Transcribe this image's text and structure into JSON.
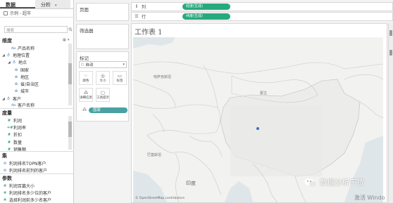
{
  "left_pane": {
    "tabs": [
      "数据",
      "分析"
    ],
    "data_source": "示例 - 超市",
    "search_placeholder": "搜索",
    "dimensions_header": "维度",
    "dimensions": [
      {
        "label": "产品名称",
        "icon": "abc-icon",
        "indent": 2
      },
      {
        "label": "地理位置",
        "icon": "hierarchy-icon",
        "indent": 0,
        "expanded": true
      },
      {
        "label": "地点",
        "icon": "hierarchy-icon",
        "indent": 1,
        "expanded": true
      },
      {
        "label": "国家",
        "icon": "globe-icon",
        "indent": 2
      },
      {
        "label": "地区",
        "icon": "globe-icon",
        "indent": 2
      },
      {
        "label": "省/自治区",
        "icon": "globe-icon",
        "indent": 2
      },
      {
        "label": "城市",
        "icon": "globe-icon",
        "indent": 2
      },
      {
        "label": "客户",
        "icon": "hierarchy-icon",
        "indent": 0,
        "expanded": true
      },
      {
        "label": "客户名称",
        "icon": "abc-icon",
        "indent": 2
      }
    ],
    "measures_header": "度量",
    "measures": [
      "利润",
      "利润率",
      "折扣",
      "数量",
      "销售额"
    ],
    "sets_header": "集",
    "sets": [
      "利润排名TOPN客户",
      "利润排名前列的客户"
    ],
    "params_header": "参数",
    "params": [
      "利润百篇大小",
      "利润排名多少位的客户",
      "选择利润前多少名客户"
    ]
  },
  "cards": {
    "pages": "页面",
    "filters": "筛选器",
    "marks": "标记",
    "mark_type": "自动",
    "buttons": [
      {
        "label": "颜色",
        "icon": "color-icon"
      },
      {
        "label": "大小",
        "icon": "size-icon"
      },
      {
        "label": "标签",
        "icon": "label-icon"
      },
      {
        "label": "详细信息",
        "icon": "detail-icon"
      },
      {
        "label": "工具提示",
        "icon": "tooltip-icon"
      }
    ],
    "detail_pill": "国家"
  },
  "shelves": {
    "columns_label": "列",
    "columns_pill": "经度(生成)",
    "rows_label": "行",
    "rows_pill": "纬度(生成)"
  },
  "view": {
    "sheet_title": "工作表 1",
    "map_labels": [
      "哈萨克斯坦",
      "蒙古",
      "巴基斯坦",
      "印度"
    ],
    "attribution": "© OpenStreetMap contributors",
    "colors": {
      "pill_green": "#27a97e",
      "detail_pill": "#4aa1a4",
      "data_point": "#3d6fb6",
      "land": "#f2f2f0",
      "border": "#cfcfcf"
    }
  },
  "watermark": {
    "channel": "数据分析干货",
    "activate": "激活 Windo"
  }
}
